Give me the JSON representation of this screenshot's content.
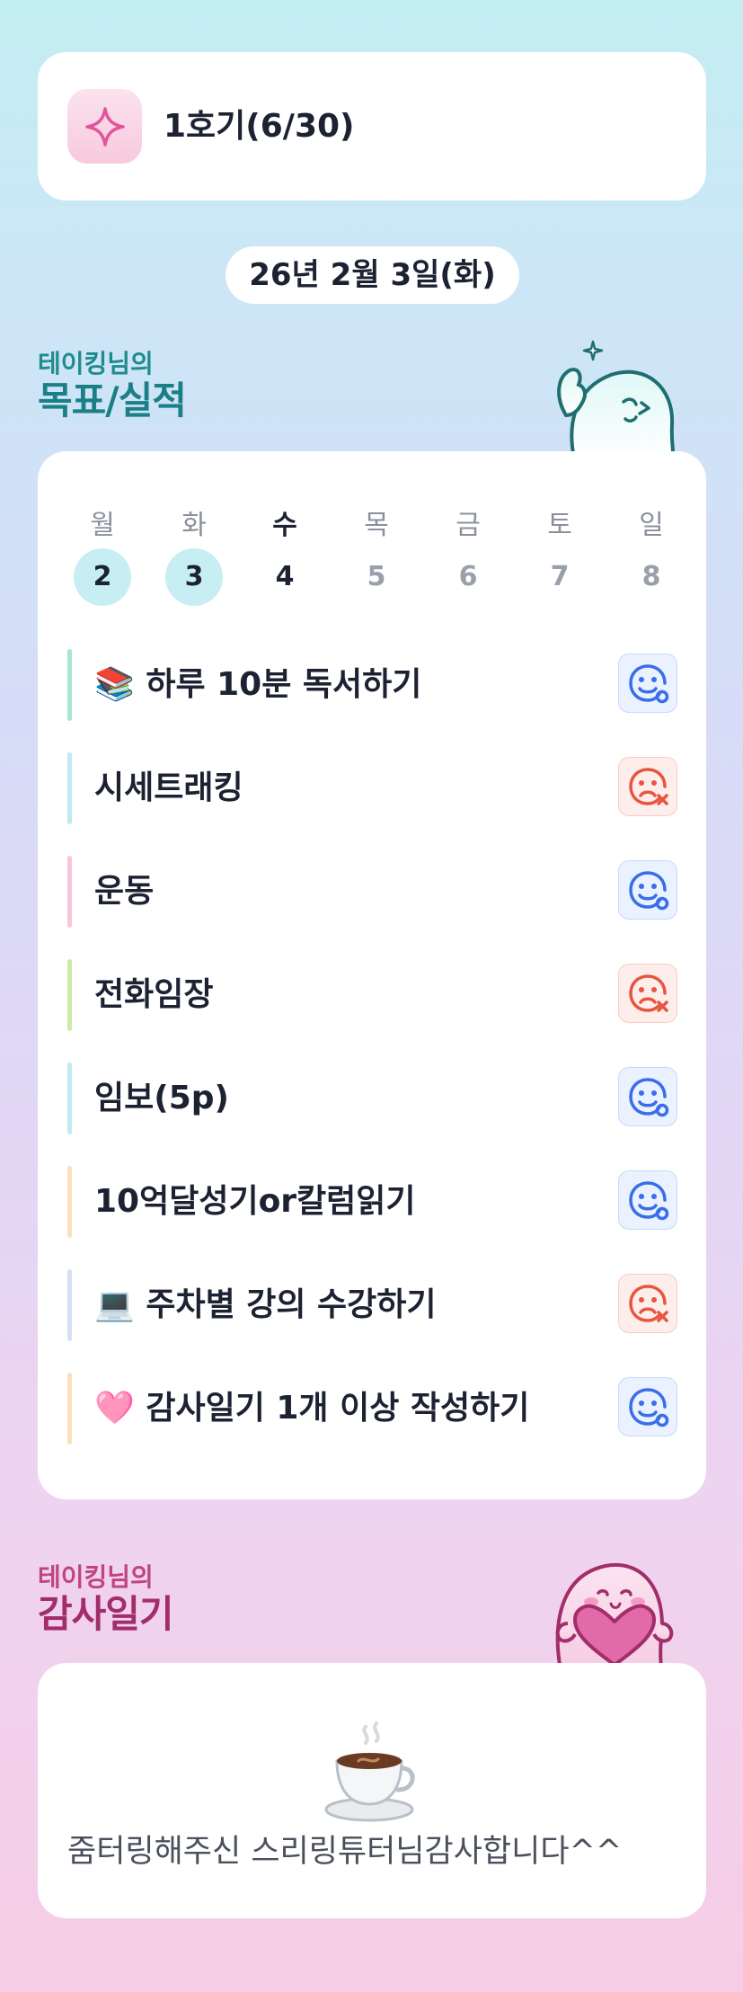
{
  "cohort": {
    "label": "1호기(6/30)",
    "badge_icon": "sparkle-icon"
  },
  "date": {
    "label": "26년 2월 3일(화)"
  },
  "goals_section": {
    "subtitle": "테이킹님의",
    "title": "목표/실적"
  },
  "week": {
    "days": [
      {
        "name": "월",
        "num": "2",
        "state": "done"
      },
      {
        "name": "화",
        "num": "3",
        "state": "done"
      },
      {
        "name": "수",
        "num": "4",
        "state": "current"
      },
      {
        "name": "목",
        "num": "5",
        "state": "future"
      },
      {
        "name": "금",
        "num": "6",
        "state": "future"
      },
      {
        "name": "토",
        "num": "7",
        "state": "future"
      },
      {
        "name": "일",
        "num": "8",
        "state": "future"
      }
    ]
  },
  "goals": [
    {
      "label": "📚 하루 10분 독서하기",
      "status": "success",
      "color": "#a8e6d2"
    },
    {
      "label": "시세트래킹",
      "status": "fail",
      "color": "#bfeaf0"
    },
    {
      "label": "운동",
      "status": "success",
      "color": "#f7c6dc"
    },
    {
      "label": "전화임장",
      "status": "fail",
      "color": "#cdeaa6"
    },
    {
      "label": "임보(5p)",
      "status": "success",
      "color": "#bfeaf0"
    },
    {
      "label": "10억달성기or칼럼읽기",
      "status": "success",
      "color": "#fbe0bd"
    },
    {
      "label": "💻 주차별 강의 수강하기",
      "status": "fail",
      "color": "#d5e0f2"
    },
    {
      "label": "🩷 감사일기 1개 이상 작성하기",
      "status": "success",
      "color": "#fbe0bd"
    }
  ],
  "gratitude_section": {
    "subtitle": "테이킹님의",
    "title": "감사일기"
  },
  "gratitude": {
    "icon": "coffee-cup-icon",
    "text": "줌터링해주신 스리링튜터님감사합니다^^"
  },
  "colors": {
    "success": "#3a6ee8",
    "fail": "#e8553f",
    "teal_title": "#1a7f86",
    "pink_title": "#a32d6a",
    "done_day": "#c7eef2"
  }
}
